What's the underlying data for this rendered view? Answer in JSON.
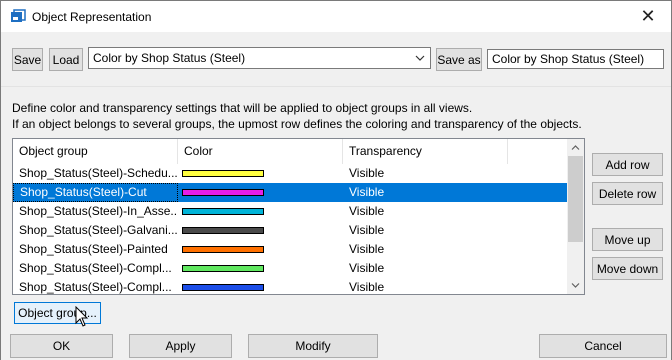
{
  "window": {
    "title": "Object Representation",
    "close_glyph": "✕"
  },
  "toolbar": {
    "save_label": "Save",
    "load_label": "Load",
    "combo_value": "Color by Shop Status (Steel)",
    "save_as_label": "Save as",
    "save_as_value": "Color by Shop Status (Steel)"
  },
  "description": {
    "line1": "Define color and transparency settings that will be applied to object groups in all views.",
    "line2": "If an object belongs to several groups, the upmost row defines the coloring and transparency of the objects."
  },
  "table": {
    "columns": [
      "Object group",
      "Color",
      "Transparency"
    ],
    "rows": [
      {
        "group": "Shop_Status(Steel)-Schedu...",
        "color": "#ffff40",
        "transparency": "Visible"
      },
      {
        "group": "Shop_Status(Steel)-Cut",
        "color": "#e81ee8",
        "transparency": "Visible"
      },
      {
        "group": "Shop_Status(Steel)-In_Asse...",
        "color": "#00b4d8",
        "transparency": "Visible"
      },
      {
        "group": "Shop_Status(Steel)-Galvani...",
        "color": "#4a4a4a",
        "transparency": "Visible"
      },
      {
        "group": "Shop_Status(Steel)-Painted",
        "color": "#ff7000",
        "transparency": "Visible"
      },
      {
        "group": "Shop_Status(Steel)-Compl...",
        "color": "#60e860",
        "transparency": "Visible"
      },
      {
        "group": "Shop_Status(Steel)-Compl...",
        "color": "#1c4ee8",
        "transparency": "Visible"
      }
    ],
    "selected_index": 1
  },
  "side_buttons": {
    "add_row": "Add row",
    "delete_row": "Delete row",
    "move_up": "Move up",
    "move_down": "Move down"
  },
  "object_group_button": "Object group...",
  "footer": {
    "ok": "OK",
    "apply": "Apply",
    "modify": "Modify",
    "cancel": "Cancel"
  },
  "colors": {
    "selection": "#0078d7",
    "focus_border": "#0078d7"
  }
}
